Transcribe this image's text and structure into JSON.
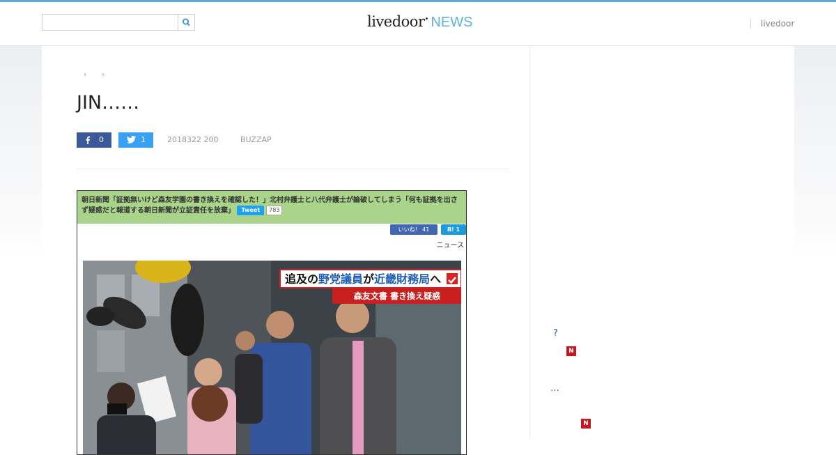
{
  "header": {
    "search_placeholder": "",
    "logo_text": "livedoor",
    "logo_news": "NEWS",
    "right_link": "livedoor",
    "accent_color": "#5fa9d3"
  },
  "breadcrumb": {
    "items": [
      "›",
      "›"
    ]
  },
  "article": {
    "title": "JIN……",
    "facebook_count": "0",
    "twitter_count": "1",
    "date": "2018322 200",
    "source": "BUZZAP"
  },
  "embed": {
    "headline": "朝日新聞「証拠無いけど森友学園の書き換えを確認した！」北村弁護士と八代弁護士が論破してしまう「何も証拠を出さず疑惑だと報道する朝日新聞が立証責任を放棄」",
    "tweet_label": "Tweet",
    "tweet_count": "783",
    "like_label": "いいね！ 41",
    "hatena_label": "B! 1",
    "category": "ニュース",
    "caption_main_a": "追及の",
    "caption_main_em1": "野党議員",
    "caption_main_b": "が",
    "caption_main_em2": "近畿財務局",
    "caption_main_c": "へ",
    "caption_sub": "森友文書 書き換え疑惑"
  },
  "sidebar": {
    "items": [
      {
        "label": "?"
      },
      {
        "badge": "N"
      },
      {
        "label": "…"
      },
      {
        "badge": "N"
      }
    ]
  },
  "icons": [
    "search-icon",
    "facebook-icon",
    "twitter-icon",
    "check-icon"
  ]
}
